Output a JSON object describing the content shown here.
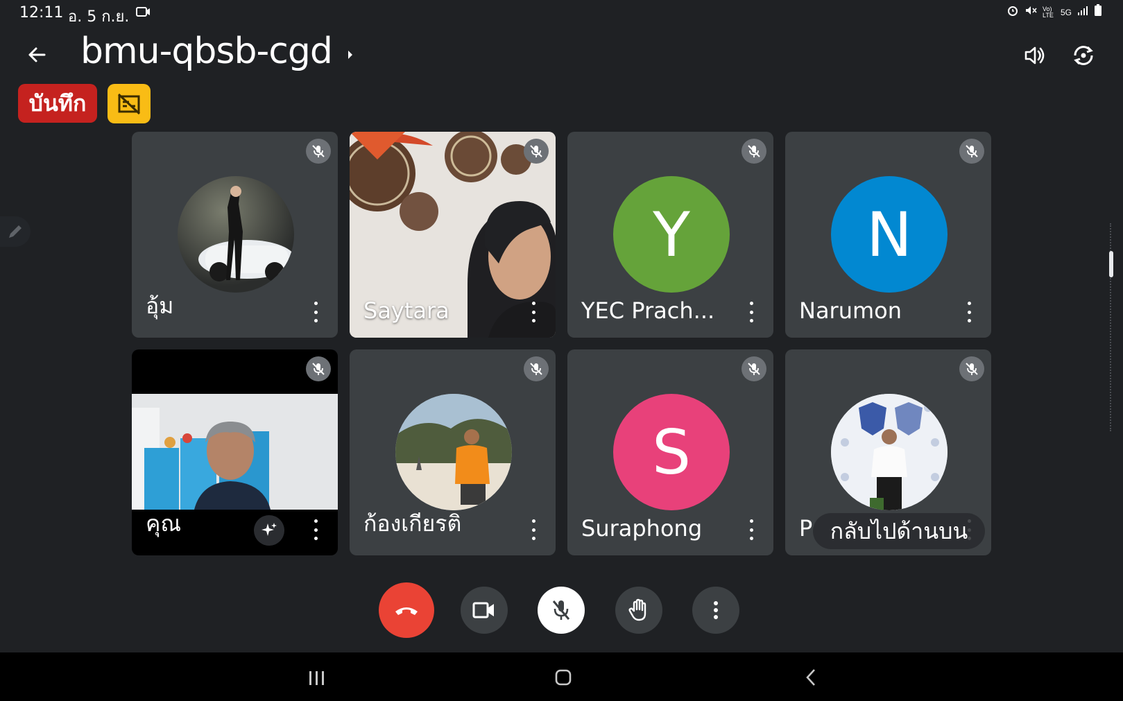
{
  "status_bar": {
    "time": "12:11",
    "date": "อ. 5 ก.ย.",
    "network": "5G",
    "volte": "Vo) LTE"
  },
  "header": {
    "meeting_code": "bmu-qbsb-cgd",
    "record_badge": "บันทึก"
  },
  "participants": [
    {
      "name": "อุ้ม",
      "avatar_type": "photo",
      "muted": true
    },
    {
      "name": "Saytara",
      "avatar_type": "video",
      "muted": true
    },
    {
      "name": "YEC Prach...",
      "avatar_type": "letter",
      "initial": "Y",
      "color": "#65a33a",
      "muted": true
    },
    {
      "name": "Narumon",
      "avatar_type": "letter",
      "initial": "N",
      "color": "#0288d1",
      "muted": true
    },
    {
      "name": "คุณ",
      "avatar_type": "video",
      "muted": true
    },
    {
      "name": "ก้องเกียรติ",
      "avatar_type": "photo",
      "muted": true
    },
    {
      "name": "Suraphong",
      "avatar_type": "letter",
      "initial": "S",
      "color": "#e8417a",
      "muted": true
    },
    {
      "name": "P",
      "avatar_type": "photo",
      "muted": true
    }
  ],
  "back_to_top_label": "กลับไปด้านบน",
  "colors": {
    "background": "#1f2124",
    "tile": "#3c4043",
    "end_call": "#ea4335",
    "record": "#c5221f",
    "captions": "#f9bc15"
  }
}
